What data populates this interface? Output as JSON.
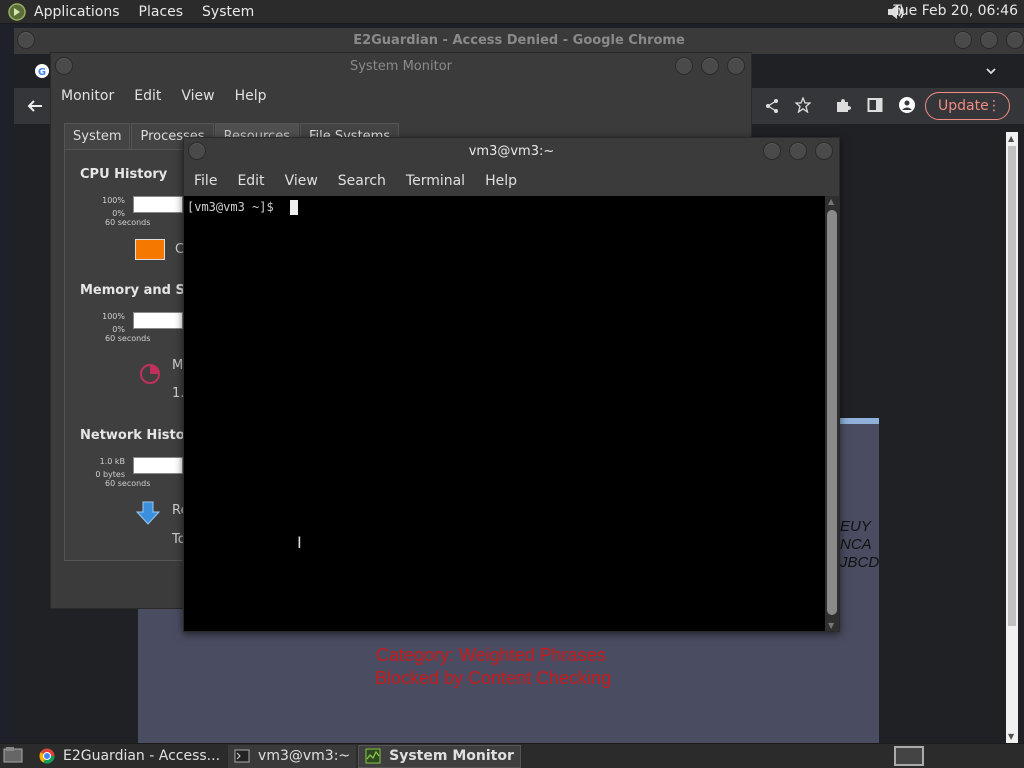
{
  "top_panel": {
    "menus": [
      "Applications",
      "Places",
      "System"
    ],
    "clock": "Tue Feb 20, 06:46"
  },
  "chrome": {
    "title": "E2Guardian - Access Denied - Google Chrome",
    "update_label": "Update",
    "blocked_text": {
      "category": "Category: Weighted Phrases",
      "reason": "Blocked by Content Checking",
      "partial_lines": [
        "EUY",
        "NCA",
        "JBCD"
      ]
    }
  },
  "system_monitor": {
    "title": "System Monitor",
    "menus": [
      "Monitor",
      "Edit",
      "View",
      "Help"
    ],
    "tabs": [
      "System",
      "Processes",
      "Resources",
      "File Systems"
    ],
    "active_tab": "Resources",
    "sections": {
      "cpu": {
        "heading": "CPU History",
        "axis_top": "100%",
        "axis_bottom": "0%",
        "axis_x": "60 seconds",
        "legend_fragment": "C",
        "legend_color": "#f57900"
      },
      "memory": {
        "heading": "Memory and Swa",
        "axis_top": "100%",
        "axis_bottom": "0%",
        "axis_x": "60 seconds",
        "legend_fragment": "M",
        "value_fragment": "1."
      },
      "network": {
        "heading": "Network History",
        "axis_top": "1.0 kB",
        "axis_bottom": "0 bytes",
        "axis_x": "60 seconds",
        "legend_fragment_1": "Re",
        "legend_fragment_2": "To"
      }
    }
  },
  "terminal": {
    "title": "vm3@vm3:~",
    "menus": [
      "File",
      "Edit",
      "View",
      "Search",
      "Terminal",
      "Help"
    ],
    "prompt": "[vm3@vm3 ~]$ "
  },
  "taskbar": {
    "tasks": [
      {
        "label": "E2Guardian - Access..."
      },
      {
        "label": "vm3@vm3:~"
      },
      {
        "label": "System Monitor"
      }
    ]
  },
  "colors": {
    "blocked_text": "#c81a1a",
    "accent_orange": "#f57900",
    "chrome_update": "#f28b82"
  }
}
